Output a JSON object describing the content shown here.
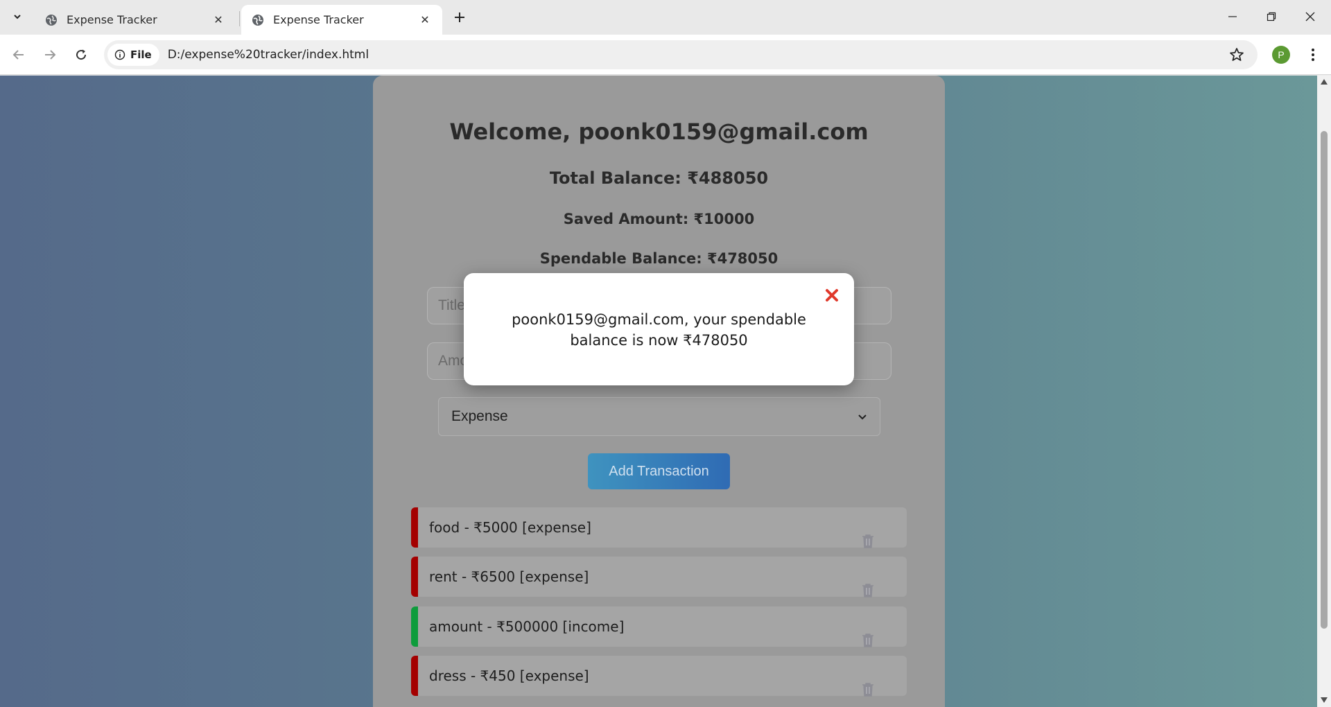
{
  "browser": {
    "tabs": [
      {
        "title": "Expense Tracker",
        "active": false
      },
      {
        "title": "Expense Tracker",
        "active": true
      }
    ],
    "site_chip_label": "File",
    "url": "D:/expense%20tracker/index.html",
    "profile_initial": "P",
    "profile_color": "#5b9a32"
  },
  "page": {
    "welcome": "Welcome, poonk0159@gmail.com",
    "total_balance": "Total Balance: ₹488050",
    "saved_amount": "Saved Amount: ₹10000",
    "spendable_balance": "Spendable Balance: ₹478050",
    "title_placeholder": "Title",
    "amount_placeholder": "Amo",
    "type_select": "Expense",
    "add_button": "Add Transaction",
    "transactions": [
      {
        "text": "food - ₹5000 [expense]",
        "kind": "expense"
      },
      {
        "text": "rent - ₹6500 [expense]",
        "kind": "expense"
      },
      {
        "text": "amount - ₹500000 [income]",
        "kind": "income"
      },
      {
        "text": "dress - ₹450 [expense]",
        "kind": "expense"
      }
    ]
  },
  "modal": {
    "message": "poonk0159@gmail.com, your spendable balance is now ₹478050",
    "close_icon": "close-icon"
  },
  "colors": {
    "expense": "#a40000",
    "income": "#0e9c3c",
    "modal_close": "#e0392b",
    "button_gradient": [
      "#3f93bf",
      "#2f6bb4"
    ]
  }
}
